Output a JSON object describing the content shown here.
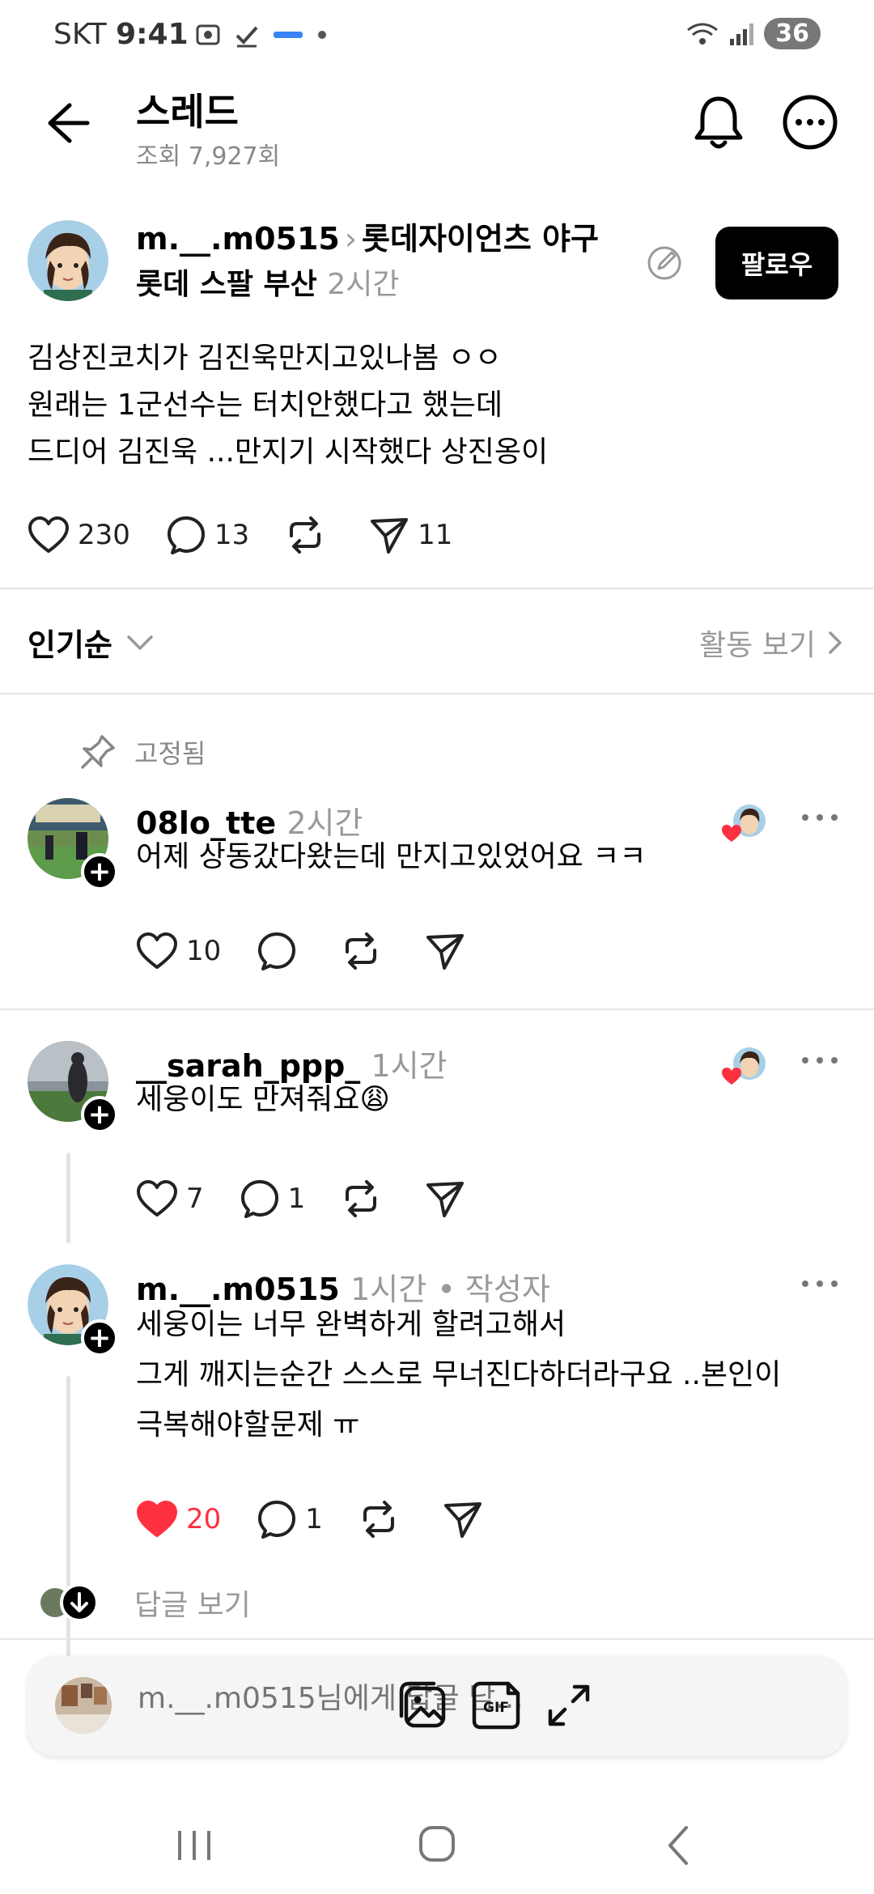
{
  "status_bar": {
    "carrier": "SKT",
    "time": "9:41",
    "battery": "36"
  },
  "header": {
    "title": "스레드",
    "views": "조회 7,927회"
  },
  "post": {
    "username": "m.__.m0515",
    "community": "롯데자이언츠 야구",
    "tag": "롯데 스팔 부산",
    "time": "2시간",
    "follow_label": "팔로우",
    "lines": [
      "김상진코치가 김진욱만지고있나봄 ㅇㅇ",
      "원래는 1군선수는 터치안했다고 했는데",
      "드디어 김진욱 ...만지기 시작했다 상진옹이"
    ],
    "likes": "230",
    "comments": "13",
    "shares": "11"
  },
  "sort": {
    "label": "인기순",
    "activity": "활동 보기"
  },
  "pinned_label": "고정됨",
  "replies": [
    {
      "username": "08lo_tte",
      "time": "2시간",
      "text": "어제 상동갔다왔는데 만지고있었어요 ㅋㅋ",
      "likes": "10",
      "comments": ""
    },
    {
      "username": "__sarah_ppp_",
      "time": "1시간",
      "text": "세웅이도 만져줘요😩",
      "likes": "7",
      "comments": "1"
    },
    {
      "username": "m.__.m0515",
      "time": "1시간",
      "author_tag": "• 작성자",
      "lines": [
        "세웅이는 너무 완벽하게 할려고해서",
        "그게 깨지는순간 스스로 무너진다하더라구요 ..본인이",
        "극복해야할문제 ㅠ"
      ],
      "likes": "20",
      "comments": "1"
    }
  ],
  "view_replies": "답글 보기",
  "compose": {
    "placeholder": "m.__.m0515님에게 답글 남..."
  },
  "colors": {
    "like_red": "#ff3040",
    "muted": "#999999"
  }
}
